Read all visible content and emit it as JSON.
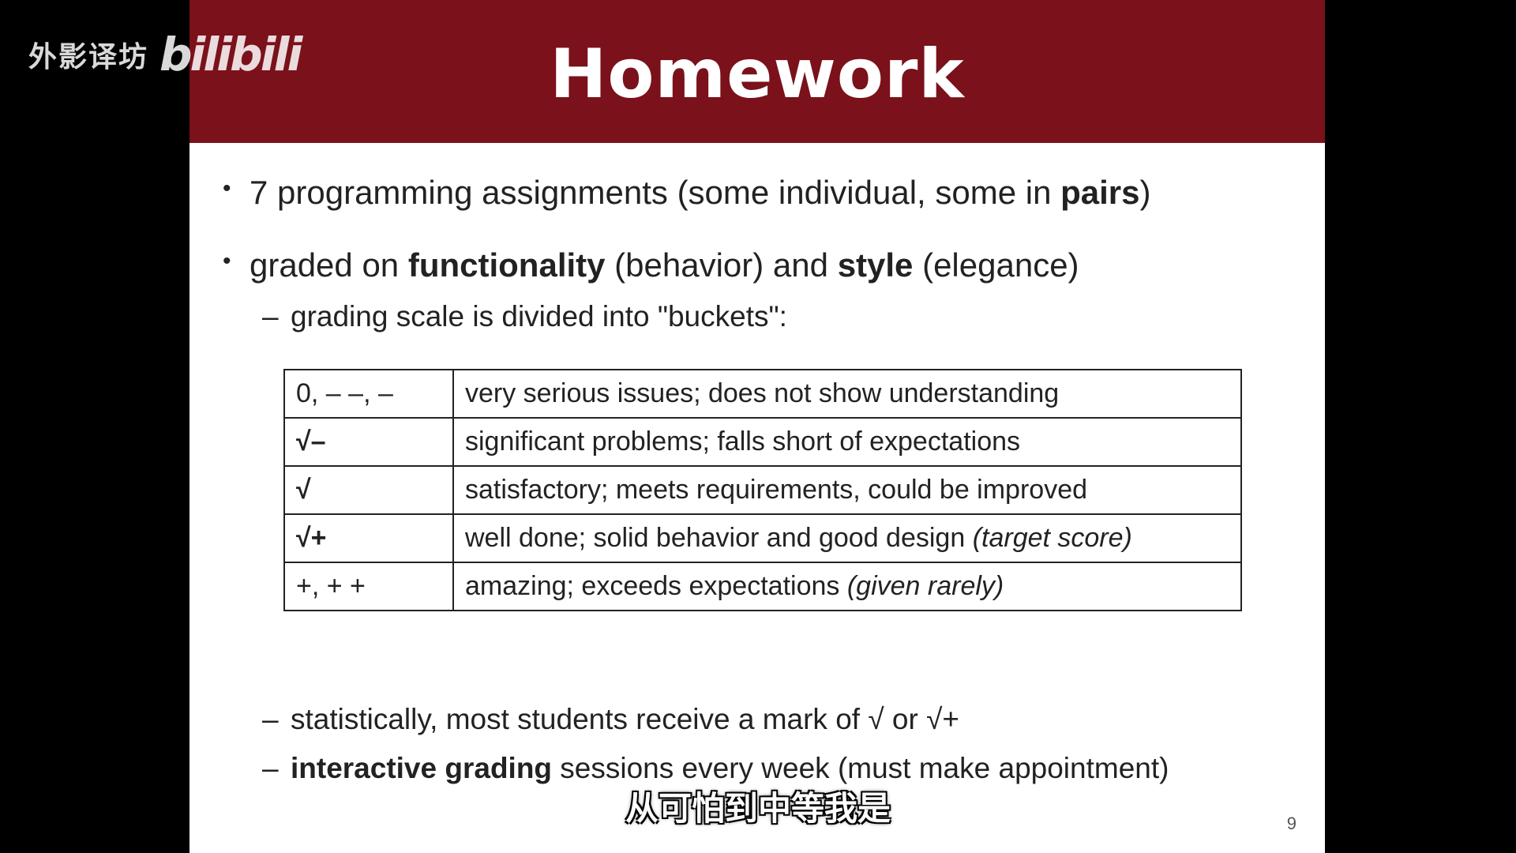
{
  "watermark": {
    "text": "外影译坊",
    "logo": "bilibili"
  },
  "slide": {
    "title": "Homework",
    "bullets": [
      {
        "parts": [
          "7 programming assignments  (some individual, some in ",
          "pairs",
          ")"
        ]
      },
      {
        "parts": [
          "graded on ",
          "functionality",
          " (behavior) and ",
          "style",
          " (elegance)"
        ]
      }
    ],
    "sub_intro": "grading scale is divided into \"buckets\":",
    "table": [
      {
        "mark": "0,  – –,  –",
        "desc": "very serious issues; does not show understanding",
        "note": ""
      },
      {
        "mark": "√–",
        "desc": "significant problems; falls short of expectations",
        "note": ""
      },
      {
        "mark": "√",
        "desc": "satisfactory; meets requirements, could be improved",
        "note": ""
      },
      {
        "mark": "√+",
        "desc": "well done; solid behavior and good design  ",
        "note": "(target score)"
      },
      {
        "mark": "+,  + +",
        "desc": "amazing; exceeds expectations  ",
        "note": "(given rarely)"
      }
    ],
    "sub_bottom": [
      {
        "bold": "",
        "text": "statistically, most students receive a mark of √ or √+"
      },
      {
        "bold": "interactive grading",
        "text": " sessions every week  (must make appointment)"
      }
    ],
    "page_number": "9"
  },
  "subtitle": "从可怕到中等我是",
  "colors": {
    "title_bar": "#7a111b",
    "slide_bg": "#ffffff",
    "frame": "#000000"
  }
}
